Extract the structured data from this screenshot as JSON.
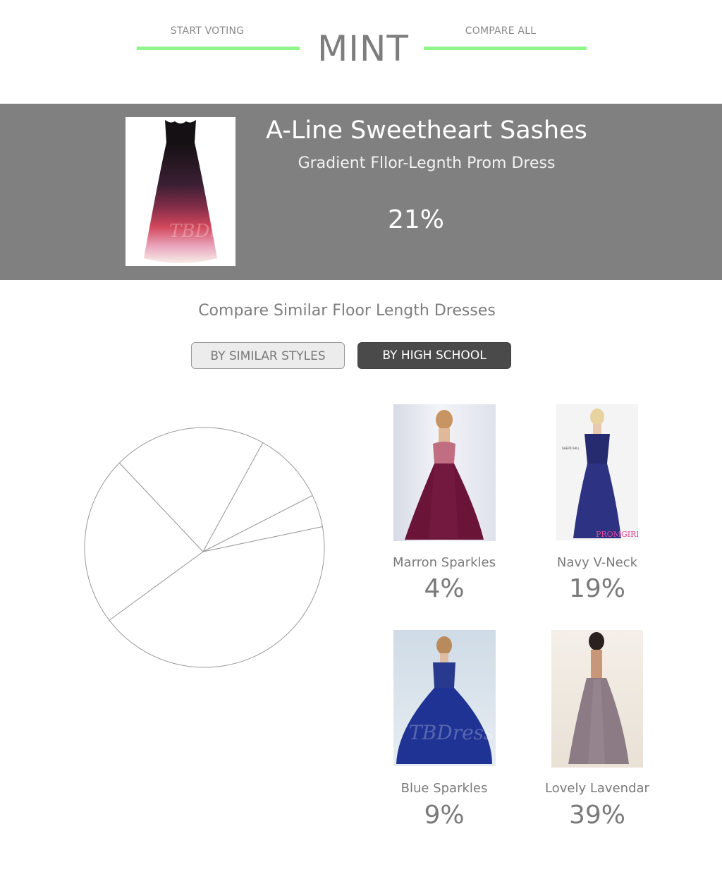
{
  "nav": {
    "start_voting": "START VOTING",
    "compare_all": "COMPARE ALL",
    "logo": "MINT",
    "accent_color": "#90f58a"
  },
  "hero": {
    "title": "A-Line Sweetheart Sashes",
    "subtitle": "Gradient Fllor-Legnth Prom Dress",
    "percent": "21%",
    "image_watermark": "TBDress",
    "background_color": "#808080"
  },
  "compare": {
    "title": "Compare Similar Floor Length Dresses",
    "btn_similar_styles": "BY SIMILAR STYLES",
    "btn_high_school": "BY HIGH SCHOOL"
  },
  "chart_data": {
    "type": "pie",
    "slices": [
      {
        "label": "Lovely Lavendar",
        "value": 39
      },
      {
        "label": "A-Line Sweetheart Sashes",
        "value": 21
      },
      {
        "label": "Navy V-Neck",
        "value": 19
      },
      {
        "label": "Blue Sparkles",
        "value": 9
      },
      {
        "label": "Marron Sparkles",
        "value": 4
      }
    ]
  },
  "dresses": [
    {
      "name": "Marron Sparkles",
      "percent": "4%"
    },
    {
      "name": "Navy V-Neck",
      "percent": "19%",
      "image_watermark": "PROMGIRL",
      "image_tag": "SHERRI HILL"
    },
    {
      "name": "Blue Sparkles",
      "percent": "9%",
      "image_watermark": "TBDress"
    },
    {
      "name": "Lovely Lavendar",
      "percent": "39%"
    }
  ]
}
